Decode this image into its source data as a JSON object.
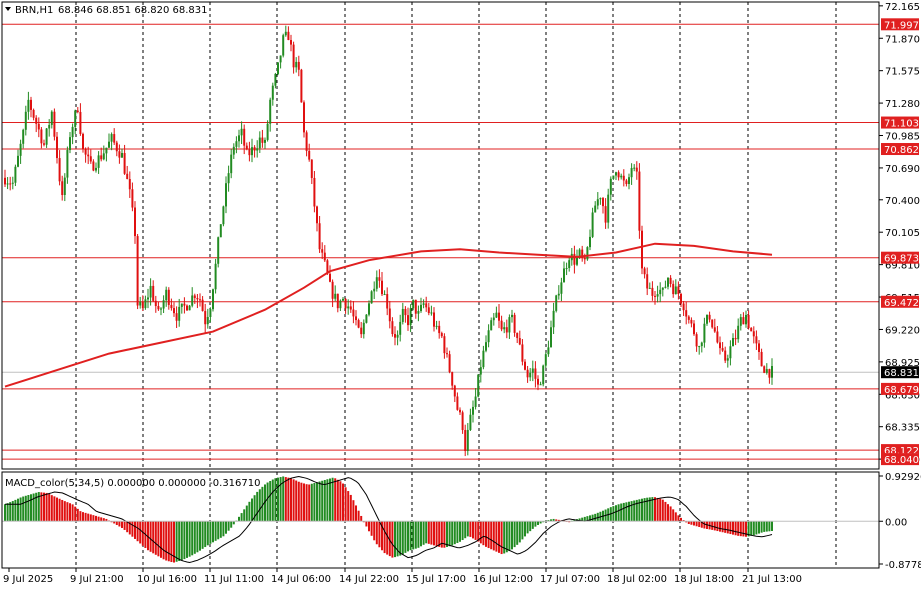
{
  "header": {
    "symbol": "BRN,H1",
    "ohlc": "68.846 68.851 68.820 68.831"
  },
  "macd": {
    "label": "MACD_color(5,34,5) 0.000000 0.000000 -0.316710",
    "axis_labels": [
      "0.929263",
      "0.00",
      "-0.877843"
    ]
  },
  "colors": {
    "bull": "#228B22",
    "bear": "#E01010",
    "level_line": "#E02020",
    "ma_line": "#E02020",
    "grid": "#000000",
    "current_price_bg": "#000000"
  },
  "chart_data": {
    "type": "candlestick",
    "price_axis": {
      "range": [
        67.95,
        72.2
      ],
      "tick_labels": [
        "72.165",
        "71.870",
        "71.575",
        "71.280",
        "70.985",
        "70.690",
        "70.400",
        "70.105",
        "69.810",
        "69.515",
        "69.220",
        "68.925",
        "68.630",
        "68.335",
        "68.040"
      ]
    },
    "time_axis": {
      "tick_labels": [
        "9 Jul 2025",
        "9 Jul 21:00",
        "10 Jul 16:00",
        "11 Jul 11:00",
        "14 Jul 06:00",
        "14 Jul 22:00",
        "15 Jul 17:00",
        "16 Jul 12:00",
        "17 Jul 07:00",
        "18 Jul 02:00",
        "18 Jul 18:00",
        "21 Jul 13:00"
      ]
    },
    "levels": [
      {
        "value": 71.997,
        "label": "71.997"
      },
      {
        "value": 71.103,
        "label": "71.103"
      },
      {
        "value": 70.862,
        "label": "70.862"
      },
      {
        "value": 69.873,
        "label": "69.873"
      },
      {
        "value": 69.472,
        "label": "69.472"
      },
      {
        "value": 68.679,
        "label": "68.679"
      },
      {
        "value": 68.122,
        "label": "68.122"
      },
      {
        "value": 68.04,
        "label": "68.040"
      }
    ],
    "current_price": {
      "value": 68.831,
      "label": "68.831"
    },
    "close_path": [
      [
        0,
        70.6
      ],
      [
        3,
        70.55
      ],
      [
        7,
        71.0
      ],
      [
        9,
        71.3
      ],
      [
        12,
        71.1
      ],
      [
        15,
        70.9
      ],
      [
        18,
        71.2
      ],
      [
        20,
        70.8
      ],
      [
        22,
        70.4
      ],
      [
        25,
        71.0
      ],
      [
        28,
        71.25
      ],
      [
        30,
        70.85
      ],
      [
        33,
        70.7
      ],
      [
        37,
        70.8
      ],
      [
        41,
        70.95
      ],
      [
        45,
        70.8
      ],
      [
        48,
        70.45
      ],
      [
        50,
        70.1
      ],
      [
        51,
        69.45
      ],
      [
        53,
        69.4
      ],
      [
        56,
        69.6
      ],
      [
        59,
        69.35
      ],
      [
        62,
        69.55
      ],
      [
        66,
        69.35
      ],
      [
        70,
        69.45
      ],
      [
        73,
        69.55
      ],
      [
        75,
        69.5
      ],
      [
        77,
        69.3
      ],
      [
        79,
        69.45
      ],
      [
        81,
        69.8
      ],
      [
        83,
        70.2
      ],
      [
        86,
        70.65
      ],
      [
        88,
        70.9
      ],
      [
        91,
        71.0
      ],
      [
        93,
        70.8
      ],
      [
        95,
        70.85
      ],
      [
        98,
        70.95
      ],
      [
        100,
        70.9
      ],
      [
        102,
        71.3
      ],
      [
        105,
        71.6
      ],
      [
        107,
        71.85
      ],
      [
        109,
        71.9
      ],
      [
        111,
        71.65
      ],
      [
        113,
        71.55
      ],
      [
        115,
        71.0
      ],
      [
        117,
        70.75
      ],
      [
        119,
        70.35
      ],
      [
        121,
        69.95
      ],
      [
        123,
        69.8
      ],
      [
        125,
        69.6
      ],
      [
        128,
        69.45
      ],
      [
        130,
        69.5
      ],
      [
        133,
        69.4
      ],
      [
        135,
        69.25
      ],
      [
        137,
        69.15
      ],
      [
        139,
        69.4
      ],
      [
        141,
        69.55
      ],
      [
        143,
        69.75
      ],
      [
        145,
        69.6
      ],
      [
        147,
        69.45
      ],
      [
        149,
        69.2
      ],
      [
        151,
        69.15
      ],
      [
        153,
        69.35
      ],
      [
        155,
        69.3
      ],
      [
        157,
        69.45
      ],
      [
        159,
        69.35
      ],
      [
        161,
        69.45
      ],
      [
        164,
        69.35
      ],
      [
        166,
        69.2
      ],
      [
        168,
        69.15
      ],
      [
        170,
        68.95
      ],
      [
        172,
        68.75
      ],
      [
        174,
        68.5
      ],
      [
        176,
        68.35
      ],
      [
        177,
        68.15
      ],
      [
        179,
        68.4
      ],
      [
        181,
        68.6
      ],
      [
        183,
        68.9
      ],
      [
        185,
        69.1
      ],
      [
        187,
        69.25
      ],
      [
        189,
        69.35
      ],
      [
        191,
        69.2
      ],
      [
        193,
        69.25
      ],
      [
        195,
        69.3
      ],
      [
        197,
        69.15
      ],
      [
        199,
        68.95
      ],
      [
        201,
        68.8
      ],
      [
        203,
        68.85
      ],
      [
        205,
        68.7
      ],
      [
        207,
        68.85
      ],
      [
        209,
        69.1
      ],
      [
        211,
        69.35
      ],
      [
        213,
        69.6
      ],
      [
        215,
        69.75
      ],
      [
        217,
        69.9
      ],
      [
        219,
        69.85
      ],
      [
        221,
        69.9
      ],
      [
        223,
        69.8
      ],
      [
        225,
        70.1
      ],
      [
        227,
        70.35
      ],
      [
        229,
        70.45
      ],
      [
        231,
        70.25
      ],
      [
        233,
        70.55
      ],
      [
        235,
        70.7
      ],
      [
        237,
        70.6
      ],
      [
        239,
        70.5
      ],
      [
        241,
        70.7
      ],
      [
        243,
        70.6
      ],
      [
        244,
        70.15
      ],
      [
        245,
        69.75
      ],
      [
        247,
        69.6
      ],
      [
        249,
        69.55
      ],
      [
        251,
        69.6
      ],
      [
        253,
        69.55
      ],
      [
        255,
        69.7
      ],
      [
        257,
        69.6
      ],
      [
        259,
        69.55
      ],
      [
        261,
        69.45
      ],
      [
        263,
        69.3
      ],
      [
        265,
        69.2
      ],
      [
        267,
        69.05
      ],
      [
        269,
        69.25
      ],
      [
        271,
        69.35
      ],
      [
        273,
        69.2
      ],
      [
        275,
        69.0
      ],
      [
        277,
        68.95
      ],
      [
        279,
        69.05
      ],
      [
        281,
        69.15
      ],
      [
        283,
        69.3
      ],
      [
        285,
        69.35
      ],
      [
        287,
        69.2
      ],
      [
        289,
        69.05
      ],
      [
        291,
        68.9
      ],
      [
        293,
        68.85
      ],
      [
        295,
        68.831
      ]
    ],
    "ma_path": [
      [
        0,
        68.7
      ],
      [
        20,
        68.85
      ],
      [
        40,
        69.0
      ],
      [
        60,
        69.1
      ],
      [
        80,
        69.2
      ],
      [
        100,
        69.4
      ],
      [
        115,
        69.6
      ],
      [
        125,
        69.75
      ],
      [
        140,
        69.85
      ],
      [
        160,
        69.93
      ],
      [
        175,
        69.95
      ],
      [
        190,
        69.92
      ],
      [
        205,
        69.9
      ],
      [
        220,
        69.88
      ],
      [
        235,
        69.92
      ],
      [
        250,
        70.0
      ],
      [
        265,
        69.98
      ],
      [
        280,
        69.93
      ],
      [
        295,
        69.9
      ]
    ],
    "macd_values": [
      0.35,
      0.42,
      0.5,
      0.55,
      0.6,
      0.58,
      0.5,
      0.42,
      0.35,
      0.2,
      0.15,
      0.1,
      0.05,
      -0.05,
      -0.15,
      -0.3,
      -0.45,
      -0.6,
      -0.7,
      -0.8,
      -0.85,
      -0.8,
      -0.72,
      -0.62,
      -0.5,
      -0.4,
      -0.3,
      -0.1,
      0.15,
      0.4,
      0.62,
      0.78,
      0.88,
      0.92,
      0.88,
      0.8,
      0.75,
      0.8,
      0.85,
      0.9,
      0.8,
      0.55,
      0.2,
      -0.15,
      -0.45,
      -0.65,
      -0.75,
      -0.7,
      -0.6,
      -0.55,
      -0.45,
      -0.5,
      -0.55,
      -0.5,
      -0.42,
      -0.3,
      -0.4,
      -0.52,
      -0.6,
      -0.68,
      -0.6,
      -0.45,
      -0.25,
      -0.1,
      0.0,
      0.05,
      0.02,
      0.0,
      0.05,
      0.1,
      0.15,
      0.22,
      0.3,
      0.36,
      0.4,
      0.44,
      0.48,
      0.5,
      0.45,
      0.3,
      0.1,
      -0.05,
      -0.1,
      -0.15,
      -0.18,
      -0.22,
      -0.26,
      -0.3,
      -0.32,
      -0.28,
      -0.22,
      -0.2
    ]
  }
}
